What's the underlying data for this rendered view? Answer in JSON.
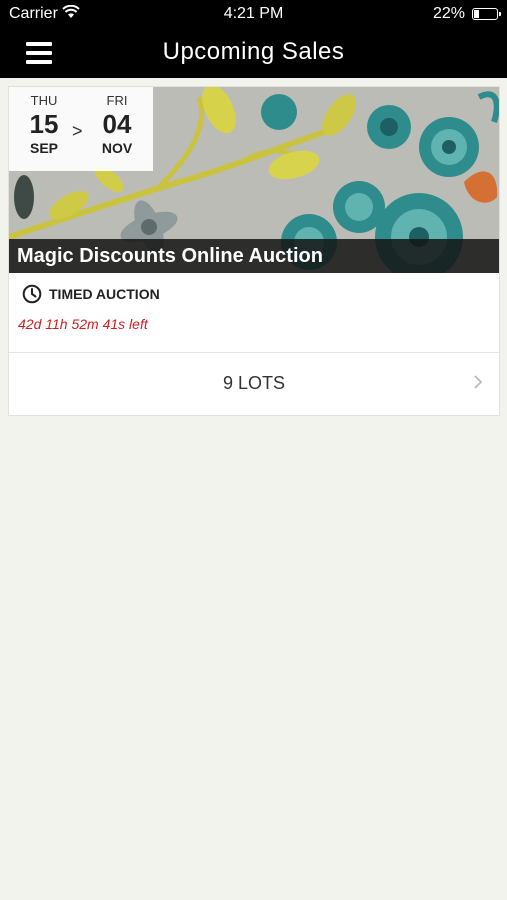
{
  "status_bar": {
    "carrier": "Carrier",
    "time": "4:21 PM",
    "battery": "22%",
    "battery_level": 0.22
  },
  "nav": {
    "title": "Upcoming Sales",
    "menu_icon": "hamburger-menu-icon"
  },
  "sale": {
    "start": {
      "dow": "THU",
      "day": "15",
      "month": "SEP"
    },
    "separator": ">",
    "end": {
      "dow": "FRI",
      "day": "04",
      "month": "NOV"
    },
    "title": "Magic Discounts Online Auction",
    "type": "TIMED AUCTION",
    "type_icon": "clock-icon",
    "countdown": "42d 11h 52m 41s left",
    "lots": "9 LOTS",
    "lots_icon": "chevron-right-icon"
  },
  "colors": {
    "bar": "#000000",
    "background": "#f3f3ee",
    "countdown": "#d01e1e"
  }
}
